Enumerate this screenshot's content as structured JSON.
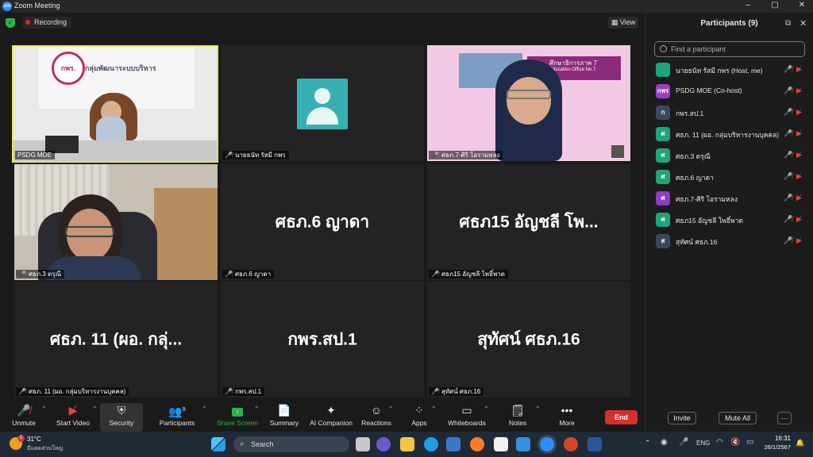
{
  "window": {
    "title": "Zoom Meeting",
    "app_icon": "zoom-icon"
  },
  "top_bar": {
    "recording_label": "Recording",
    "view_label": "View"
  },
  "tiles": {
    "t1": {
      "label": "PSDG MOE",
      "sign_text": "กลุ่มพัฒนาระบบบริหาร",
      "logo_text": "กพร."
    },
    "t2": {
      "label": "นายธนัท รัสมี กพร"
    },
    "t3": {
      "label": "ศธภ.7-ศิริ โอรามหลง",
      "banner_text": "ศึกษาธิการภาค 7",
      "banner_sub": "Education Office No.7"
    },
    "t4": {
      "label": "ศธภ.3 ดรุณี"
    },
    "t5": {
      "label": "ศธภ.6 ญาดา",
      "big": "ศธภ.6 ญาดา"
    },
    "t6": {
      "label": "ศธภ15 อัญชลี โพธิ์พาด",
      "big": "ศธภ15 อัญชลี โพ..."
    },
    "t7": {
      "label": "ศธภ. 11 (ผอ. กลุ่มบริหารงานบุคคล)",
      "big": "ศธภ. 11 (ผอ. กลุ่..."
    },
    "t8": {
      "label": "กพร.สป.1",
      "big": "กพร.สป.1"
    },
    "t9": {
      "label": "สุทัศน์ ศธภ.16",
      "big": "สุทัศน์ ศธภ.16"
    }
  },
  "panel": {
    "title": "Participants (9)",
    "search_placeholder": "Find a participant",
    "participants": [
      {
        "initial": "",
        "name": "นายธนัท รัสมี กพร (Host, me)",
        "color": "#1fa37a"
      },
      {
        "initial": "กพร",
        "name": "PSDG MOE (Co-host)",
        "color": "#9b3cc9"
      },
      {
        "initial": "ก",
        "name": "กพร.สป.1",
        "color": "#3a4a5c"
      },
      {
        "initial": "ศ",
        "name": "ศธภ. 11 (ผอ. กลุ่มบริหารงานบุคคล)",
        "color": "#1fa37a"
      },
      {
        "initial": "ศ",
        "name": "ศธภ.3 ดรุณี",
        "color": "#1fa37a"
      },
      {
        "initial": "ศ",
        "name": "ศธภ.6 ญาดา",
        "color": "#1fa37a"
      },
      {
        "initial": "ศ",
        "name": "ศธภ.7-ศิริ โอรามหลง",
        "color": "#8e3cc9"
      },
      {
        "initial": "ศ",
        "name": "ศธภ15 อัญชลี โพธิ์พาด",
        "color": "#1fa37a"
      },
      {
        "initial": "ส",
        "name": "สุทัศน์ ศธภ.16",
        "color": "#3a4a5c"
      }
    ],
    "invite_label": "Invite",
    "mute_all_label": "Mute All",
    "more_label": "···"
  },
  "toolbar": {
    "unmute": "Unmute",
    "start_video": "Start Video",
    "security": "Security",
    "participants": "Participants",
    "participants_count": "9",
    "share_screen": "Share Screen",
    "summary": "Summary",
    "ai_companion": "AI Companion",
    "reactions": "Reactions",
    "apps": "Apps",
    "whiteboards": "Whiteboards",
    "notes": "Notes",
    "more": "More",
    "end": "End"
  },
  "taskbar": {
    "weather_temp": "31°C",
    "weather_desc": "มีแดดส่วนใหญ่",
    "weather_badge": "1",
    "search_label": "Search",
    "lang": "ENG",
    "time": "16:31",
    "date": "26/1/2567"
  },
  "colors": {
    "accent": "#2d8cff",
    "end": "#d32f2f",
    "mute": "#e04444",
    "active_border": "#e8e85a"
  }
}
